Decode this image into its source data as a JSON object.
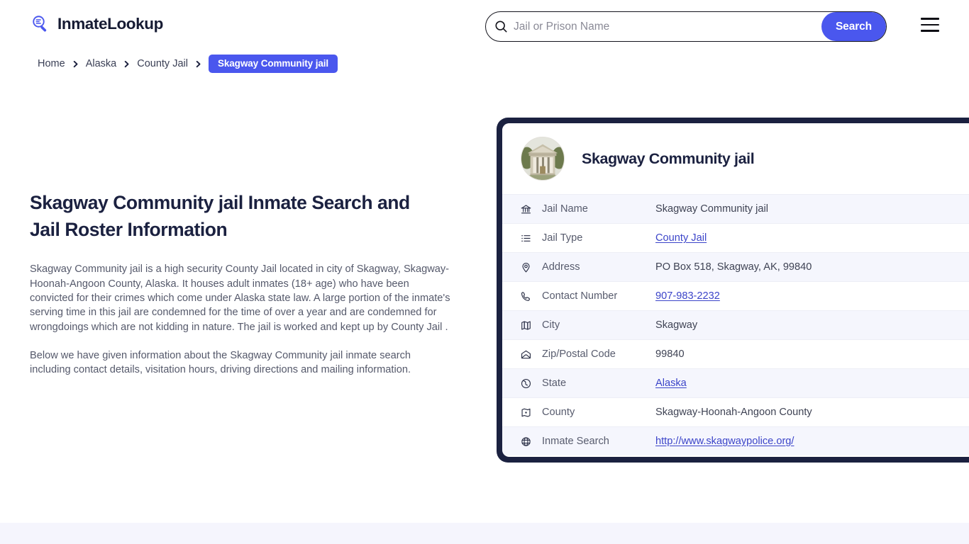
{
  "header": {
    "brand_name": "InmateLookup",
    "brand_icon": "magnifier-list-icon",
    "search": {
      "placeholder": "Jail or Prison Name",
      "value": "",
      "icon": "search-icon",
      "button_label": "Search"
    },
    "menu_icon": "hamburger-menu-icon"
  },
  "breadcrumb": {
    "items": [
      {
        "label": "Home"
      },
      {
        "label": "Alaska"
      },
      {
        "label": "County Jail"
      }
    ],
    "current": "Skagway Community jail",
    "separator_icon": "chevron-right-icon"
  },
  "main": {
    "title": "Skagway Community jail Inmate Search and Jail Roster Information",
    "paragraphs": [
      "Skagway Community jail is a high security County Jail located in city of Skagway, Skagway-Hoonah-Angoon County, Alaska. It houses adult inmates (18+ age) who have been convicted for their crimes which come under Alaska state law. A large portion of the inmate's serving time in this jail are condemned for the time of over a year and are condemned for wrongdoings which are not kidding in nature. The jail is worked and kept up by County Jail .",
      "Below we have given information about the Skagway Community jail inmate search including contact details, visitation hours, driving directions and mailing information."
    ]
  },
  "card": {
    "thumbnail_icon": "courthouse-building-photo",
    "title": "Skagway Community jail",
    "rows": [
      {
        "icon": "bank-icon",
        "label": "Jail Name",
        "value": "Skagway Community jail",
        "link": false
      },
      {
        "icon": "list-icon",
        "label": "Jail Type",
        "value": "County Jail",
        "link": true
      },
      {
        "icon": "map-pin-icon",
        "label": "Address",
        "value": "PO Box 518, Skagway, AK, 99840",
        "link": false
      },
      {
        "icon": "phone-icon",
        "label": "Contact Number",
        "value": "907-983-2232",
        "link": true
      },
      {
        "icon": "map-icon",
        "label": "City",
        "value": "Skagway",
        "link": false
      },
      {
        "icon": "envelope-icon",
        "label": "Zip/Postal Code",
        "value": "99840",
        "link": false
      },
      {
        "icon": "globe-icon",
        "label": "State",
        "value": "Alaska",
        "link": true
      },
      {
        "icon": "county-map-icon",
        "label": "County",
        "value": "Skagway-Hoonah-Angoon County",
        "link": false
      },
      {
        "icon": "web-globe-icon",
        "label": "Inmate Search",
        "value": "http://www.skagwaypolice.org/",
        "link": true
      }
    ]
  },
  "colors": {
    "accent_blue": "#4a57ee",
    "link_blue": "#3b44c9",
    "navy": "#1b2140",
    "row_alt": "#f5f6fd",
    "footer_band": "#f5f5fd"
  }
}
